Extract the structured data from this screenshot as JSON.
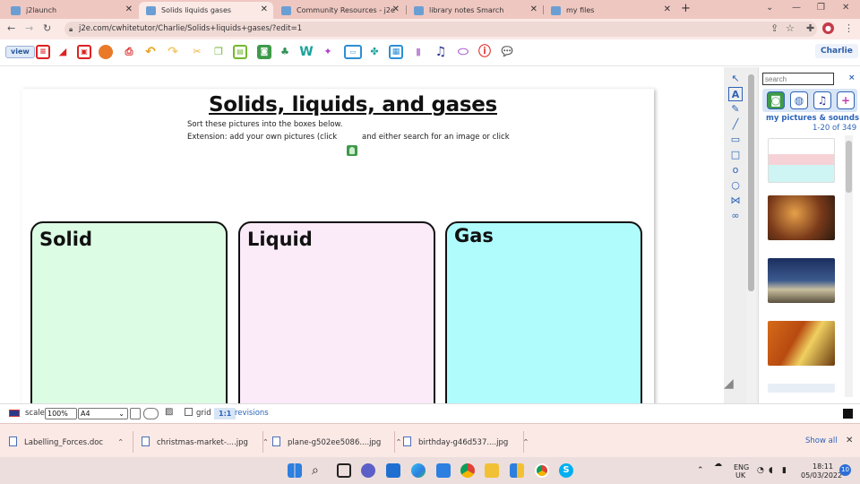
{
  "browser": {
    "tabs": [
      {
        "label": "j2launch",
        "active": false
      },
      {
        "label": "Solids liquids gases",
        "active": true
      },
      {
        "label": "Community Resources - j2e",
        "active": false
      },
      {
        "label": "library notes Smarch",
        "active": false
      },
      {
        "label": "my files",
        "active": false
      }
    ],
    "url": "j2e.com/cwhitetutor/Charlie/Solids+liquids+gases/?edit=1"
  },
  "toolbar": {
    "view_label": "view",
    "user_label": "Charlie"
  },
  "document": {
    "title": "Solids, liquids, and gases",
    "instruction_1": "Sort these pictures into the boxes below.",
    "instruction_2": "Extension: add your own pictures (click",
    "instruction_3": "and either search for an image or click",
    "boxes": [
      {
        "label": "Solid",
        "color": "#dcfce4"
      },
      {
        "label": "Liquid",
        "color": "#fbeaf8"
      },
      {
        "label": "Gas",
        "color": "#b0fcfc"
      }
    ]
  },
  "right_panel": {
    "search_placeholder": "search",
    "close_label": "×",
    "title": "my pictures & sounds",
    "count": "1-20 of 349"
  },
  "statusbar": {
    "scale_label": "scale",
    "scale_value": "100%",
    "paper_value": "A4",
    "grid_label": "grid",
    "one_to_one": "1:1",
    "revisions_label": "revisions"
  },
  "downloads": {
    "items": [
      "Labelling_Forces.doc",
      "christmas-market-....jpg",
      "plane-g502ee5086....jpg",
      "birthday-g46d537....jpg"
    ],
    "show_all": "Show all"
  },
  "taskbar": {
    "lang_1": "ENG",
    "lang_2": "UK",
    "time": "18:11",
    "date": "05/03/2022",
    "notifications": "10"
  },
  "colors": {
    "accent": "#2c63b8",
    "tab_strip": "#efc7c1"
  }
}
